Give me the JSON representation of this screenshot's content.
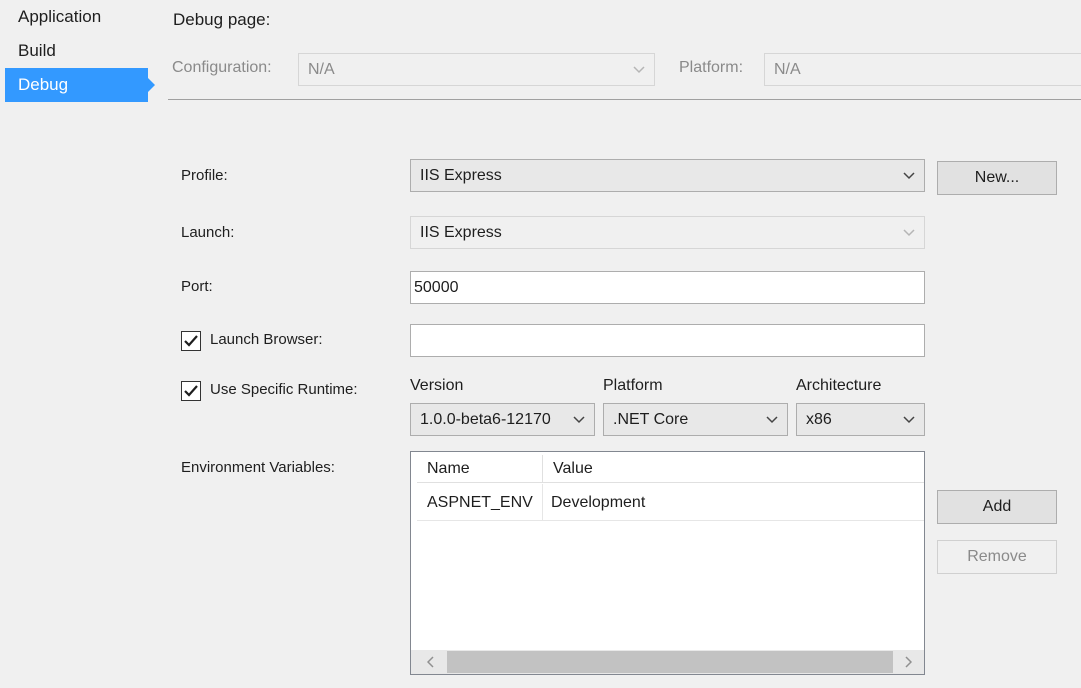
{
  "sidebar": {
    "items": [
      {
        "label": "Application",
        "active": false
      },
      {
        "label": "Build",
        "active": false
      },
      {
        "label": "Debug",
        "active": true
      }
    ]
  },
  "header": {
    "page_title": "Debug page:",
    "configuration_label": "Configuration:",
    "configuration_value": "N/A",
    "platform_label": "Platform:",
    "platform_value": "N/A"
  },
  "form": {
    "profile_label": "Profile:",
    "profile_value": "IIS Express",
    "new_button": "New...",
    "launch_label": "Launch:",
    "launch_value": "IIS Express",
    "port_label": "Port:",
    "port_value": "50000",
    "launch_browser_label": "Launch Browser:",
    "launch_browser_checked": true,
    "launch_browser_value": "",
    "use_specific_runtime_label": "Use Specific Runtime:",
    "use_specific_runtime_checked": true,
    "version_label": "Version",
    "version_value": "1.0.0-beta6-12170",
    "platform_label": "Platform",
    "platform_value": ".NET Core",
    "architecture_label": "Architecture",
    "architecture_value": "x86",
    "env_vars_label": "Environment Variables:"
  },
  "env_table": {
    "columns": [
      "Name",
      "Value"
    ],
    "rows": [
      {
        "name": "ASPNET_ENV",
        "value": "Development"
      }
    ],
    "add_button": "Add",
    "remove_button": "Remove"
  },
  "icons": {
    "dropdown": "chevron-down-icon",
    "check": "checkmark-icon",
    "scroll_left": "chevron-left-icon",
    "scroll_right": "chevron-right-icon"
  },
  "colors": {
    "accent": "#3399ff",
    "background": "#f0f0f0"
  }
}
